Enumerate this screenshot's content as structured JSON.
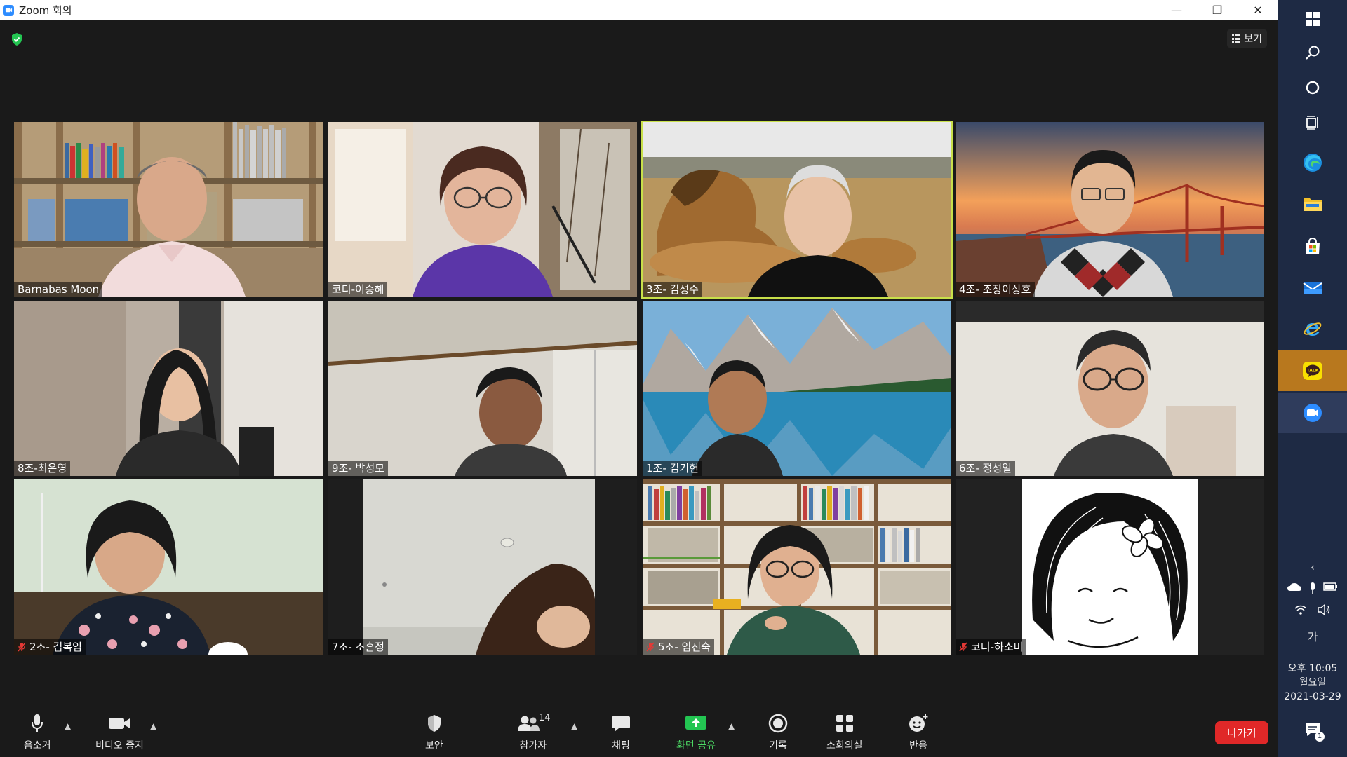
{
  "window": {
    "title": "Zoom 회의",
    "minimize": "—",
    "restore": "❐",
    "close": "✕"
  },
  "header": {
    "view_label": "보기"
  },
  "participants": [
    {
      "name": "Barnabas Moon",
      "muted": false
    },
    {
      "name": "코디-이승혜",
      "muted": false
    },
    {
      "name": "3조- 김성수",
      "muted": false,
      "active_speaker": true
    },
    {
      "name": "4조- 조장이상호",
      "muted": false
    },
    {
      "name": "8조-최은영",
      "muted": false
    },
    {
      "name": "9조- 박성모",
      "muted": false
    },
    {
      "name": "1조- 김기헌",
      "muted": false
    },
    {
      "name": "6조- 정성일",
      "muted": false
    },
    {
      "name": "2조- 김복임",
      "muted": true
    },
    {
      "name": "7조- 조흔정",
      "muted": false
    },
    {
      "name": "5조- 임진숙",
      "muted": true
    },
    {
      "name": "코디-하소미",
      "muted": true
    }
  ],
  "toolbar": {
    "mute_label": "음소거",
    "video_label": "비디오 중지",
    "security_label": "보안",
    "participants_label": "참가자",
    "participants_count": "14",
    "chat_label": "채팅",
    "share_label": "화면 공유",
    "record_label": "기록",
    "breakout_label": "소회의실",
    "reactions_label": "반응",
    "leave_label": "나가기"
  },
  "taskbar": {
    "ime_label": "가",
    "clock_ampm_time": "오후 10:05",
    "clock_day": "월요일",
    "clock_date": "2021-03-29",
    "notification_count": "1"
  },
  "colors": {
    "active_speaker_border": "#c8e04a",
    "leave_button": "#e02828",
    "share_green": "#4cd964",
    "muted_red": "#e53935"
  }
}
